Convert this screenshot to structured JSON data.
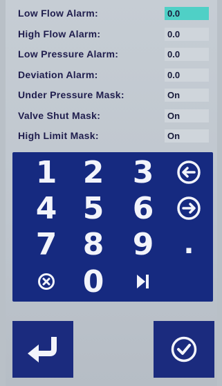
{
  "settings": [
    {
      "label": "Low Flow Alarm:",
      "value": "0.0",
      "selected": true
    },
    {
      "label": "High Flow Alarm:",
      "value": "0.0",
      "selected": false
    },
    {
      "label": "Low Pressure Alarm:",
      "value": "0.0",
      "selected": false
    },
    {
      "label": "Deviation Alarm:",
      "value": "0.0",
      "selected": false
    },
    {
      "label": "Under Pressure Mask:",
      "value": "On",
      "selected": false
    },
    {
      "label": "Valve Shut Mask:",
      "value": "On",
      "selected": false
    },
    {
      "label": "High Limit Mask:",
      "value": "On",
      "selected": false
    }
  ],
  "keypad": {
    "digits": [
      "1",
      "2",
      "3",
      "4",
      "5",
      "6",
      "7",
      "8",
      "9",
      "0"
    ],
    "decimal": ".",
    "icons": {
      "backspace": "arrow-left-circle-icon",
      "forward": "arrow-right-circle-icon",
      "clear": "clear-circle-icon",
      "next_field": "skip-next-icon"
    }
  },
  "buttons": {
    "enter_icon": "return-arrow-icon",
    "confirm_icon": "check-circle-icon"
  },
  "colors": {
    "keypad_bg": "#162a80",
    "button_bg": "#1b2b7e",
    "selected_value_bg": "#4fd0c6",
    "value_bg": "#cfd5db",
    "label_text": "#1f1d4d"
  }
}
